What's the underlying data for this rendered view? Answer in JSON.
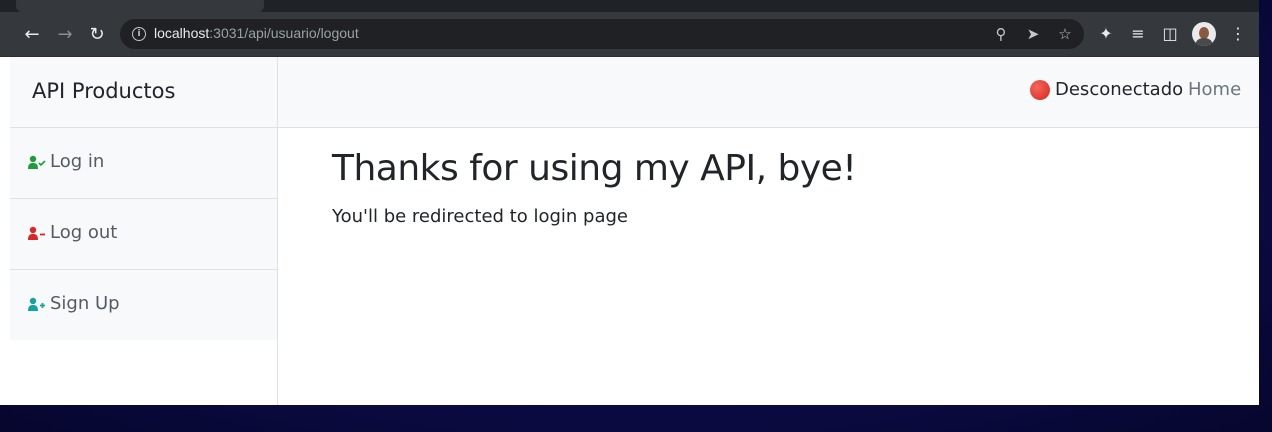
{
  "browser": {
    "url_host": "localhost",
    "url_rest": ":3031/api/usuario/logout"
  },
  "sidebar": {
    "brand": "API Productos",
    "items": [
      {
        "label": "Log in",
        "color": "#1e9e3a",
        "icon": "user-check-icon"
      },
      {
        "label": "Log out",
        "color": "#dc2626",
        "icon": "user-minus-icon"
      },
      {
        "label": "Sign Up",
        "color": "#14a3a3",
        "icon": "user-plus-icon"
      }
    ]
  },
  "topbar": {
    "status": "Desconectado",
    "status_color": "#e0362c",
    "home": "Home"
  },
  "main": {
    "heading": "Thanks for using my API, bye!",
    "subtext": "You'll be redirected to login page"
  }
}
